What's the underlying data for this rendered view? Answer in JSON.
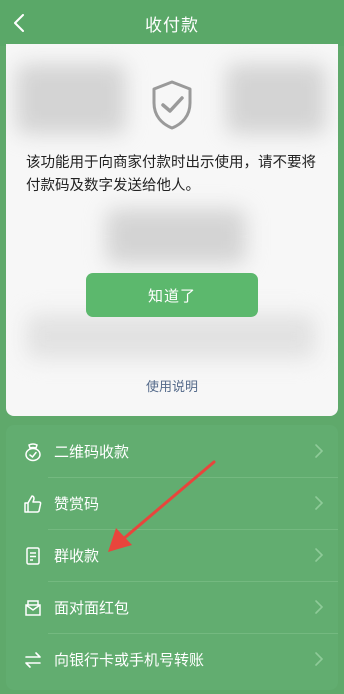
{
  "header": {
    "title": "收付款",
    "back_icon": "chevron-left-icon"
  },
  "notice": {
    "message": "该功能用于向商家付款时出示使用，请不要将付款码及数字发送给他人。",
    "confirm_button": "知道了",
    "help_link": "使用说明",
    "icon": "shield-check-icon"
  },
  "menu": {
    "items": [
      {
        "label": "二维码收款",
        "icon": "qr-receive-icon"
      },
      {
        "label": "赞赏码",
        "icon": "thumbs-up-icon"
      },
      {
        "label": "群收款",
        "icon": "group-receive-icon"
      },
      {
        "label": "面对面红包",
        "icon": "red-packet-icon"
      },
      {
        "label": "向银行卡或手机号转账",
        "icon": "transfer-icon"
      }
    ]
  },
  "annotation": {
    "color": "#e8453c"
  },
  "colors": {
    "primary_green": "#5cb86d",
    "background": "#5fa96b"
  }
}
